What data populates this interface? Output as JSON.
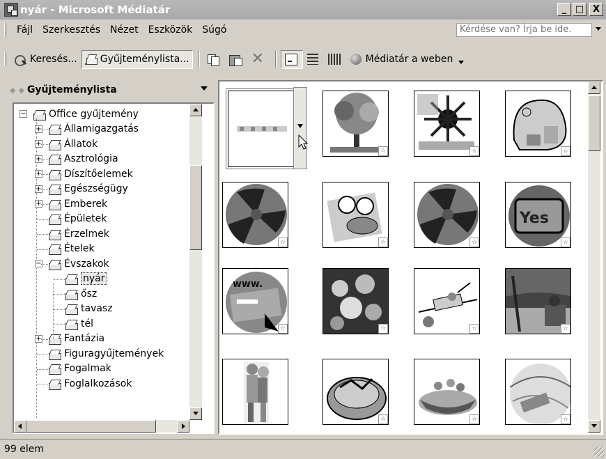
{
  "window": {
    "title": "nyár - Microsoft Médiatár",
    "minimize": "_",
    "maximize": "□",
    "close": "X"
  },
  "menu": {
    "items": [
      "Fájl",
      "Szerkesztés",
      "Nézet",
      "Eszközök",
      "Súgó"
    ],
    "help_placeholder": "Kérdése van? Írja be ide."
  },
  "toolbar": {
    "search_label": "Keresés...",
    "collection_list_label": "Gyűjteménylista...",
    "web_label": "Médiatár a weben",
    "icons": [
      "search-icon",
      "collection-list-icon",
      "copy-icon",
      "paste-icon",
      "delete-icon",
      "thumbnails-icon",
      "list-icon",
      "details-icon",
      "globe-icon"
    ]
  },
  "panel": {
    "title": "Gyűjteménylista"
  },
  "tree": {
    "root": "Office gyűjtemény",
    "items": [
      {
        "label": "Államigazgatás",
        "level": 1,
        "expander": "+"
      },
      {
        "label": "Állatok",
        "level": 1,
        "expander": "+"
      },
      {
        "label": "Asztrológia",
        "level": 1,
        "expander": "+"
      },
      {
        "label": "Díszítőelemek",
        "level": 1,
        "expander": "+"
      },
      {
        "label": "Egészségügy",
        "level": 1,
        "expander": "+"
      },
      {
        "label": "Emberek",
        "level": 1,
        "expander": "+"
      },
      {
        "label": "Épületek",
        "level": 1,
        "expander": ""
      },
      {
        "label": "Érzelmek",
        "level": 1,
        "expander": ""
      },
      {
        "label": "Ételek",
        "level": 1,
        "expander": ""
      },
      {
        "label": "Évszakok",
        "level": 1,
        "expander": "−"
      },
      {
        "label": "nyár",
        "level": 2,
        "expander": "",
        "selected": true
      },
      {
        "label": "ősz",
        "level": 2,
        "expander": ""
      },
      {
        "label": "tavasz",
        "level": 2,
        "expander": ""
      },
      {
        "label": "tél",
        "level": 2,
        "expander": ""
      },
      {
        "label": "Fantázia",
        "level": 1,
        "expander": "+"
      },
      {
        "label": "Figuragyűjtemények",
        "level": 1,
        "expander": ""
      },
      {
        "label": "Fogalmak",
        "level": 1,
        "expander": ""
      },
      {
        "label": "Foglalkozások",
        "level": 1,
        "expander": ""
      }
    ]
  },
  "clips": [
    {
      "name": "clip-border-strip"
    },
    {
      "name": "clip-tree"
    },
    {
      "name": "clip-sun"
    },
    {
      "name": "clip-sandcastle"
    },
    {
      "name": "clip-beach-ball"
    },
    {
      "name": "clip-child-float"
    },
    {
      "name": "clip-beach-ball-2"
    },
    {
      "name": "clip-yes-sign"
    },
    {
      "name": "clip-www-page"
    },
    {
      "name": "clip-flowers"
    },
    {
      "name": "clip-sunbather"
    },
    {
      "name": "clip-beach-chair"
    },
    {
      "name": "clip-couple-beach"
    },
    {
      "name": "clip-raft"
    },
    {
      "name": "clip-boat-people"
    },
    {
      "name": "clip-hammock"
    }
  ],
  "star_badge": "☆",
  "status": {
    "text": "99 elem"
  }
}
